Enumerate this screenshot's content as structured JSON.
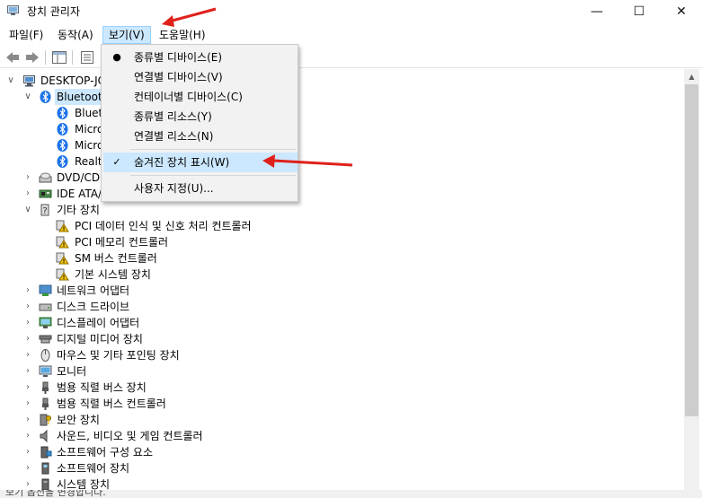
{
  "window": {
    "title": "장치 관리자",
    "minimize_glyph": "—",
    "maximize_glyph": "☐",
    "close_glyph": "✕"
  },
  "menubar": {
    "items": [
      {
        "label": "파일(F)"
      },
      {
        "label": "동작(A)"
      },
      {
        "label": "보기(V)",
        "active": true
      },
      {
        "label": "도움말(H)"
      }
    ]
  },
  "view_menu": {
    "items": [
      {
        "label": "종류별 디바이스(E)",
        "mark": "bullet",
        "glyph": "●"
      },
      {
        "label": "연결별 디바이스(V)"
      },
      {
        "label": "컨테이너별 디바이스(C)"
      },
      {
        "label": "종류별 리소스(Y)"
      },
      {
        "label": "연결별 리소스(N)"
      },
      {
        "label": "숨겨진 장치 표시(W)",
        "mark": "check",
        "glyph": "✓",
        "highlighted": true
      },
      {
        "label": "사용자 지정(U)..."
      }
    ]
  },
  "tree": {
    "root": "DESKTOP-JC",
    "bluetooth": {
      "label": "Bluetooth",
      "children": [
        "Blueto",
        "Micro",
        "Micro",
        "Realte"
      ]
    },
    "collapsed_top": [
      "DVD/CD",
      "IDE ATA/"
    ],
    "other_devices": {
      "label": "기타 장치",
      "children": [
        "PCI 데이터 인식 및 신호 처리 컨트롤러",
        "PCI 메모리 컨트롤러",
        "SM 버스 컨트롤러",
        "기본 시스템 장치"
      ]
    },
    "categories": [
      {
        "label": "네트워크 어댑터",
        "icon": "network-adapter-icon"
      },
      {
        "label": "디스크 드라이브",
        "icon": "disk-drive-icon"
      },
      {
        "label": "디스플레이 어댑터",
        "icon": "display-adapter-icon"
      },
      {
        "label": "디지털 미디어 장치",
        "icon": "media-device-icon"
      },
      {
        "label": "마우스 및 기타 포인팅 장치",
        "icon": "mouse-icon"
      },
      {
        "label": "모니터",
        "icon": "monitor-icon"
      },
      {
        "label": "범용 직렬 버스 장치",
        "icon": "usb-icon"
      },
      {
        "label": "범용 직렬 버스 컨트롤러",
        "icon": "usb-icon"
      },
      {
        "label": "보안 장치",
        "icon": "security-device-icon"
      },
      {
        "label": "사운드, 비디오 및 게임 컨트롤러",
        "icon": "speaker-icon"
      },
      {
        "label": "소프트웨어 구성 요소",
        "icon": "software-component-icon"
      },
      {
        "label": "소프트웨어 장치",
        "icon": "software-device-icon"
      },
      {
        "label": "시스템 장치",
        "icon": "system-device-icon"
      }
    ]
  },
  "statusbar": {
    "text": "보기 옵션을 변경합니다."
  },
  "colors": {
    "menu_highlight": "#cce8ff",
    "annotation_arrow": "#e0201b",
    "bluetooth_blue": "#1a73e8"
  }
}
